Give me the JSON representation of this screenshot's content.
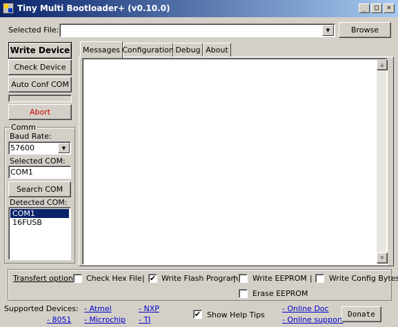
{
  "window": {
    "title": "Tiny Multi Bootloader+ (v0.10.0)",
    "min_glyph": "_",
    "max_glyph": "□",
    "close_glyph": "×"
  },
  "file": {
    "label": "Selected File:",
    "value": "",
    "browse_label": "Browse"
  },
  "left": {
    "write_label": "Write Device",
    "check_label": "Check Device",
    "autoconf_label": "Auto Conf COM",
    "progress": 0,
    "abort_label": "Abort",
    "comm_title": "Comm",
    "baud_label": "Baud Rate:",
    "baud_value": "57600",
    "selected_com_label": "Selected COM:",
    "selected_com_value": "COM1",
    "search_label": "Search COM",
    "detected_label": "Detected COM:",
    "detected_items": [
      "COM1",
      "16FUSB"
    ],
    "detected_selected": "COM1"
  },
  "tabs": [
    "Messages",
    "Configuration",
    "Debug",
    "About"
  ],
  "active_tab": "Messages",
  "options": {
    "label": "Transfert options:",
    "check_hex": {
      "label": "Check Hex File",
      "checked": false
    },
    "write_flash": {
      "label": "Write Flash Program",
      "checked": true
    },
    "write_eeprom": {
      "label": "Write EEPROM",
      "checked": false
    },
    "write_config": {
      "label": "Write Config Bytes",
      "checked": false
    },
    "erase_eeprom": {
      "label": "Erase EEPROM",
      "checked": false
    },
    "separator": "|"
  },
  "footer": {
    "supported_label": "Supported Devices:",
    "links": [
      "- 8051",
      "- Atmel",
      "- Microchip",
      "- NXP",
      "- TI"
    ],
    "help_tips": {
      "label": "Show Help Tips",
      "checked": true
    },
    "online_doc": "- Online Doc",
    "online_support": "- Online support",
    "donate": "Donate"
  },
  "colors": {
    "selection": "#0a246a",
    "abort_text": "#cc0000",
    "link": "#0000cc",
    "face": "#d4d0c8"
  }
}
